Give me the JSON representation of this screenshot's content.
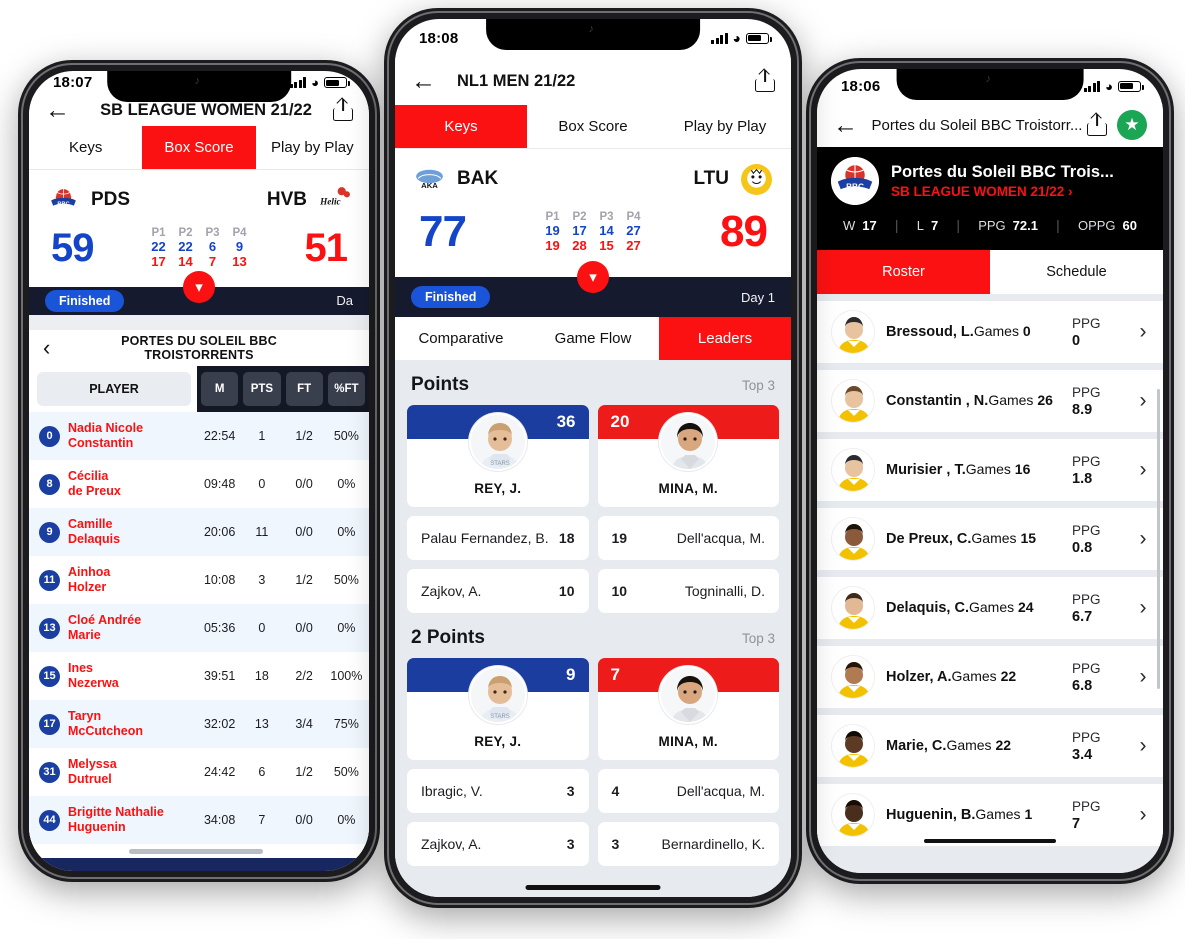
{
  "left_phone": {
    "status": {
      "time": "18:07"
    },
    "nav": {
      "back_icon": "arrow-left-icon",
      "title": "SB LEAGUE WOMEN 21/22",
      "share_icon": "share-icon"
    },
    "tabs": [
      {
        "label": "Keys",
        "active": false
      },
      {
        "label": "Box Score",
        "active": true
      },
      {
        "label": "Play by Play",
        "active": false
      }
    ],
    "scoreboard": {
      "home": {
        "abbr": "PDS",
        "score": "59"
      },
      "away": {
        "abbr": "HVB",
        "score": "51"
      },
      "period_labels": [
        "P1",
        "P2",
        "P3",
        "P4"
      ],
      "home_periods": [
        "22",
        "22",
        "6",
        "9"
      ],
      "away_periods": [
        "17",
        "14",
        "7",
        "13"
      ],
      "expand_icon": "chevron-down-icon"
    },
    "statusbar": {
      "pill": "Finished",
      "day": "Da"
    },
    "team_header": {
      "back_icon": "chevron-left-icon",
      "title": "PORTES DU SOLEIL BBC TROISTORRENTS"
    },
    "table": {
      "player_header": "PLAYER",
      "stat_headers": [
        "M",
        "PTS",
        "FT",
        "%FT"
      ],
      "rows": [
        {
          "number": "0",
          "name": "Nadia Nicole Constantin",
          "stats": [
            "22:54",
            "1",
            "1/2",
            "50%"
          ]
        },
        {
          "number": "8",
          "name": "Cécilia de Preux",
          "stats": [
            "09:48",
            "0",
            "0/0",
            "0%"
          ]
        },
        {
          "number": "9",
          "name": "Camille Delaquis",
          "stats": [
            "20:06",
            "11",
            "0/0",
            "0%"
          ]
        },
        {
          "number": "11",
          "name": "Ainhoa Holzer",
          "stats": [
            "10:08",
            "3",
            "1/2",
            "50%"
          ]
        },
        {
          "number": "13",
          "name": "Cloé Andrée Marie",
          "stats": [
            "05:36",
            "0",
            "0/0",
            "0%"
          ]
        },
        {
          "number": "15",
          "name": "Ines Nezerwa",
          "stats": [
            "39:51",
            "18",
            "2/2",
            "100%"
          ]
        },
        {
          "number": "17",
          "name": "Taryn McCutcheon",
          "stats": [
            "32:02",
            "13",
            "3/4",
            "75%"
          ]
        },
        {
          "number": "31",
          "name": "Melyssa Dutruel",
          "stats": [
            "24:42",
            "6",
            "1/2",
            "50%"
          ]
        },
        {
          "number": "44",
          "name": "Brigitte Nathalie Huguenin",
          "stats": [
            "34:08",
            "7",
            "0/0",
            "0%"
          ]
        }
      ]
    }
  },
  "center_phone": {
    "status": {
      "time": "18:08"
    },
    "nav": {
      "back_icon": "arrow-left-icon",
      "title": "NL1 MEN 21/22",
      "share_icon": "share-icon"
    },
    "tabs": [
      {
        "label": "Keys",
        "active": true
      },
      {
        "label": "Box Score",
        "active": false
      },
      {
        "label": "Play by Play",
        "active": false
      }
    ],
    "scoreboard": {
      "home": {
        "abbr": "BAK",
        "score": "77"
      },
      "away": {
        "abbr": "LTU",
        "score": "89"
      },
      "period_labels": [
        "P1",
        "P2",
        "P3",
        "P4"
      ],
      "home_periods": [
        "19",
        "17",
        "14",
        "27"
      ],
      "away_periods": [
        "19",
        "28",
        "15",
        "27"
      ],
      "expand_icon": "chevron-down-icon"
    },
    "statusbar": {
      "pill": "Finished",
      "day": "Day 1"
    },
    "subtabs": [
      {
        "label": "Comparative",
        "active": false
      },
      {
        "label": "Game Flow",
        "active": false
      },
      {
        "label": "Leaders",
        "active": true
      }
    ],
    "sections": [
      {
        "title": "Points",
        "top_label": "Top 3",
        "home_leader": {
          "name": "REY, J.",
          "value": "36"
        },
        "away_leader": {
          "name": "MINA, M.",
          "value": "20"
        },
        "rows": [
          {
            "home_name": "Palau Fernandez, B.",
            "home_value": "18",
            "away_value": "19",
            "away_name": "Dell'acqua, M."
          },
          {
            "home_name": "Zajkov, A.",
            "home_value": "10",
            "away_value": "10",
            "away_name": "Togninalli, D."
          }
        ]
      },
      {
        "title": "2 Points",
        "top_label": "Top 3",
        "home_leader": {
          "name": "REY, J.",
          "value": "9"
        },
        "away_leader": {
          "name": "MINA, M.",
          "value": "7"
        },
        "rows": [
          {
            "home_name": "Ibragic, V.",
            "home_value": "3",
            "away_value": "4",
            "away_name": "Dell'acqua, M."
          },
          {
            "home_name": "Zajkov, A.",
            "home_value": "3",
            "away_value": "3",
            "away_name": "Bernardinello, K."
          }
        ]
      }
    ]
  },
  "right_phone": {
    "status": {
      "time": "18:06"
    },
    "nav": {
      "back_icon": "arrow-left-icon",
      "title": "Portes du Soleil BBC Troistorr...",
      "share_icon": "share-icon",
      "favorite_icon": "star-icon"
    },
    "team": {
      "name": "Portes du Soleil BBC Trois...",
      "league": "SB LEAGUE WOMEN 21/22",
      "league_chevron": "chevron-right-icon",
      "stats": [
        {
          "label": "W",
          "value": "17"
        },
        {
          "label": "L",
          "value": "7"
        },
        {
          "label": "PPG",
          "value": "72.1"
        },
        {
          "label": "OPPG",
          "value": "60"
        }
      ]
    },
    "tabs": [
      {
        "label": "Roster",
        "active": true
      },
      {
        "label": "Schedule",
        "active": false
      }
    ],
    "roster_labels": {
      "games": "Games",
      "ppg": "PPG",
      "chevron": "chevron-right-icon"
    },
    "roster": [
      {
        "name": "Bressoud, L.",
        "games": "0",
        "ppg": "0"
      },
      {
        "name": "Constantin , N.",
        "games": "26",
        "ppg": "8.9"
      },
      {
        "name": "Murisier , T.",
        "games": "16",
        "ppg": "1.8"
      },
      {
        "name": "De Preux, C.",
        "games": "15",
        "ppg": "0.8"
      },
      {
        "name": "Delaquis, C.",
        "games": "24",
        "ppg": "6.7"
      },
      {
        "name": "Holzer, A.",
        "games": "22",
        "ppg": "6.8"
      },
      {
        "name": "Marie, C.",
        "games": "22",
        "ppg": "3.4"
      },
      {
        "name": "Huguenin, B.",
        "games": "1",
        "ppg": "7"
      }
    ]
  },
  "colors": {
    "accent_red": "#fb1111",
    "home_blue": "#1444c7",
    "dark_navy": "#161a2e",
    "pill_blue": "#1a54d8",
    "green": "#1aa654"
  }
}
